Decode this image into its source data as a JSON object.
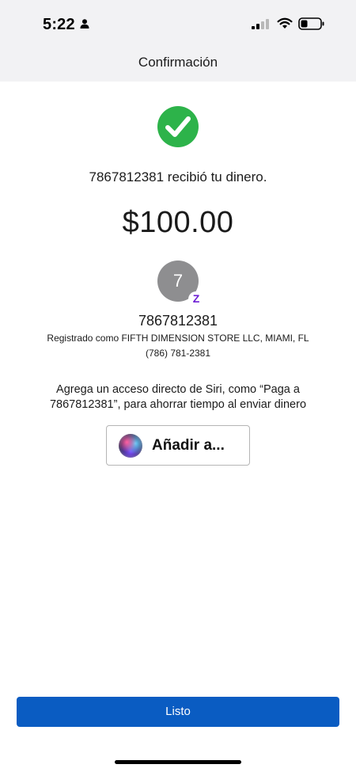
{
  "status_bar": {
    "time": "5:22",
    "icons": [
      "person-icon",
      "signal-icon",
      "wifi-icon",
      "battery-icon"
    ]
  },
  "nav": {
    "title": "Confirmación"
  },
  "confirmation": {
    "icon": "checkmark-circle-icon",
    "received_text": "7867812381 recibió tu dinero.",
    "amount": "$100.00"
  },
  "recipient": {
    "avatar_initial": "7",
    "badge": "Z",
    "name": "7867812381",
    "registered_as": "Registrado como FIFTH DIMENSION STORE LLC, MIAMI, FL",
    "phone": "(786) 781-2381"
  },
  "siri": {
    "prompt_line1": "Agrega un acceso directo de Siri, como “Paga a",
    "prompt_line2": "7867812381”, para ahorrar tiempo al enviar dinero",
    "button_label": "Añadir a..."
  },
  "footer": {
    "done_label": "Listo"
  },
  "colors": {
    "success": "#2db34a",
    "primary": "#0a5cc2",
    "zelle": "#6d1ed4",
    "header_bg": "#f2f2f4"
  }
}
